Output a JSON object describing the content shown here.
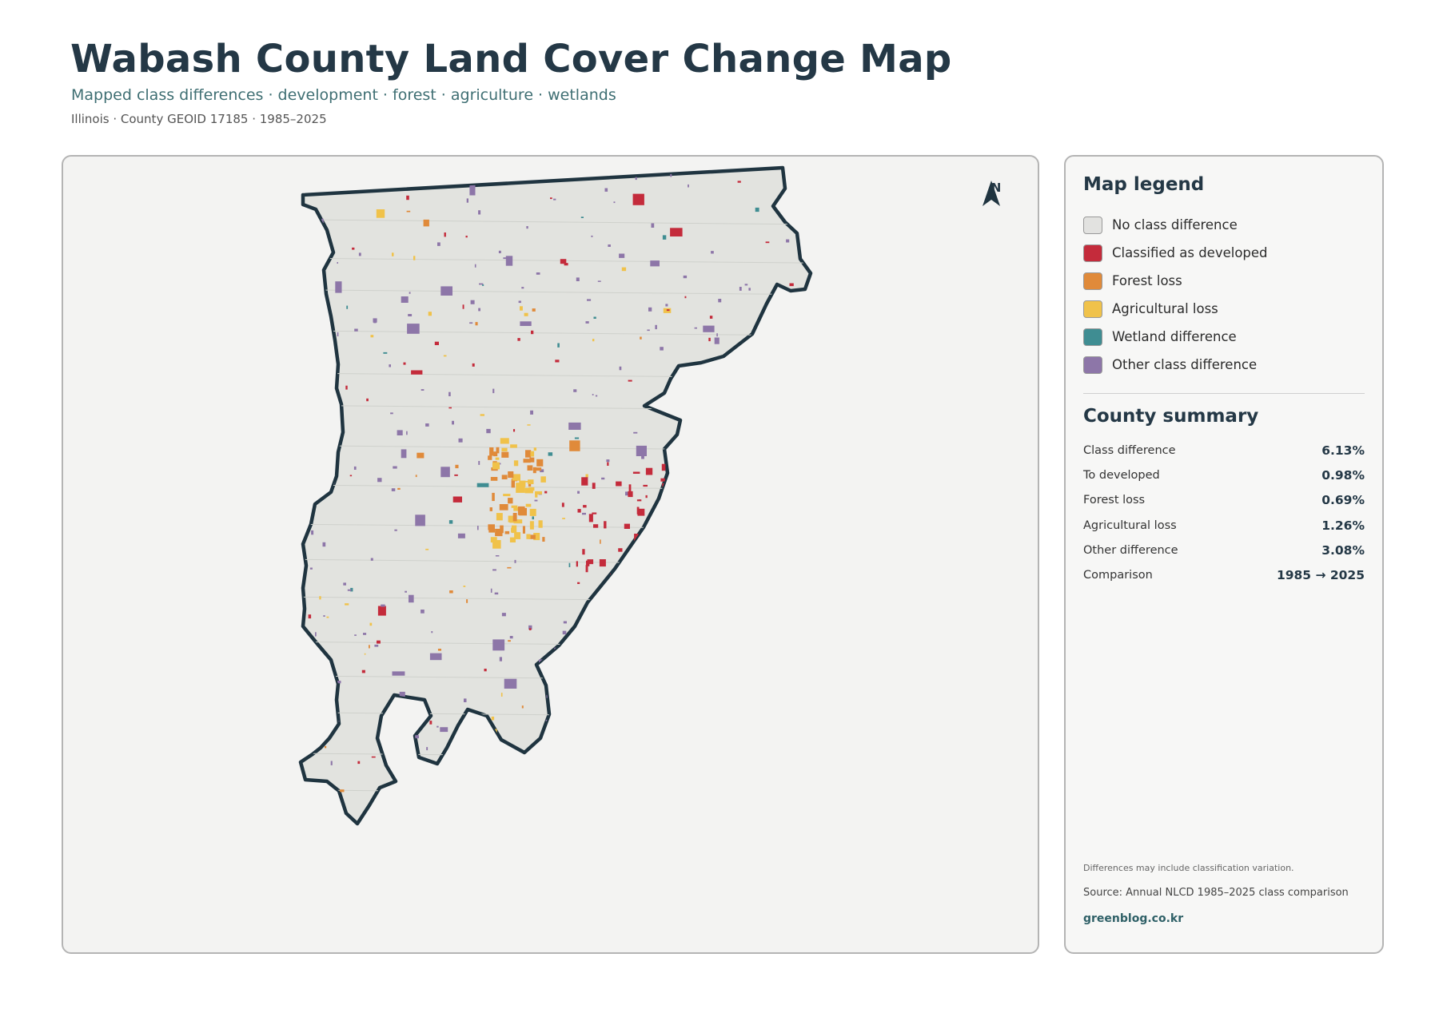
{
  "header": {
    "title": "Wabash County Land Cover Change Map",
    "subtitle": "Mapped class differences · development · forest · agriculture · wetlands",
    "meta": "Illinois · County GEOID 17185 · 1985–2025"
  },
  "map": {
    "north_label": "N",
    "colors": {
      "panel_bg": "#f3f3f2",
      "county_fill": "#e2e3df",
      "outline": "#1f3440"
    }
  },
  "legend": {
    "title": "Map legend",
    "items": [
      {
        "label": "No class difference",
        "color": "#e2e2e0"
      },
      {
        "label": "Classified as developed",
        "color": "#c42b3b"
      },
      {
        "label": "Forest loss",
        "color": "#e08a3a"
      },
      {
        "label": "Agricultural loss",
        "color": "#f0c24a"
      },
      {
        "label": "Wetland difference",
        "color": "#3f8d92"
      },
      {
        "label": "Other class difference",
        "color": "#8d76a8"
      }
    ]
  },
  "summary": {
    "title": "County summary",
    "rows": [
      {
        "label": "Class difference",
        "value": "6.13%"
      },
      {
        "label": "To developed",
        "value": "0.98%"
      },
      {
        "label": "Forest loss",
        "value": "0.69%"
      },
      {
        "label": "Agricultural loss",
        "value": "1.26%"
      },
      {
        "label": "Other difference",
        "value": "3.08%"
      },
      {
        "label": "Comparison",
        "value": "1985 → 2025"
      }
    ]
  },
  "footer": {
    "note": "Differences may include classification variation.",
    "source": "Source: Annual NLCD 1985–2025 class comparison",
    "site": "greenblog.co.kr"
  }
}
